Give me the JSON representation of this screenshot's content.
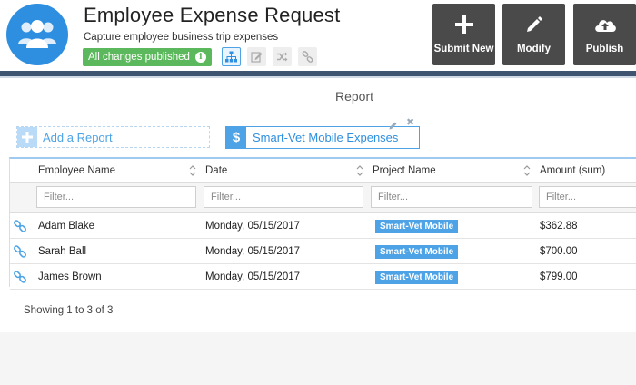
{
  "app": {
    "title": "Employee Expense Request",
    "subtitle": "Capture employee business trip expenses",
    "status_badge": "All changes published",
    "accent_color": "#2e8fe0",
    "header_bar_color": "#3f5470",
    "toolbar_icons": [
      "sitemap-icon",
      "edit-icon",
      "shuffle-icon",
      "link-icon"
    ]
  },
  "actions": {
    "submit_new": "Submit New",
    "modify": "Modify",
    "publish": "Publish"
  },
  "report": {
    "heading": "Report",
    "add_report": "Add a Report",
    "active_tab": "Smart-Vet Mobile Expenses"
  },
  "grid": {
    "columns": [
      "Employee Name",
      "Date",
      "Project Name",
      "Amount (sum)"
    ],
    "filter_placeholder": "Filter...",
    "rows": [
      {
        "employee": "Adam Blake",
        "date": "Monday, 05/15/2017",
        "project": "Smart-Vet Mobile",
        "amount": "$362.88"
      },
      {
        "employee": "Sarah Ball",
        "date": "Monday, 05/15/2017",
        "project": "Smart-Vet Mobile",
        "amount": "$700.00"
      },
      {
        "employee": "James Brown",
        "date": "Monday, 05/15/2017",
        "project": "Smart-Vet Mobile",
        "amount": "$799.00"
      }
    ],
    "footer": "Showing 1 to 3 of 3"
  }
}
